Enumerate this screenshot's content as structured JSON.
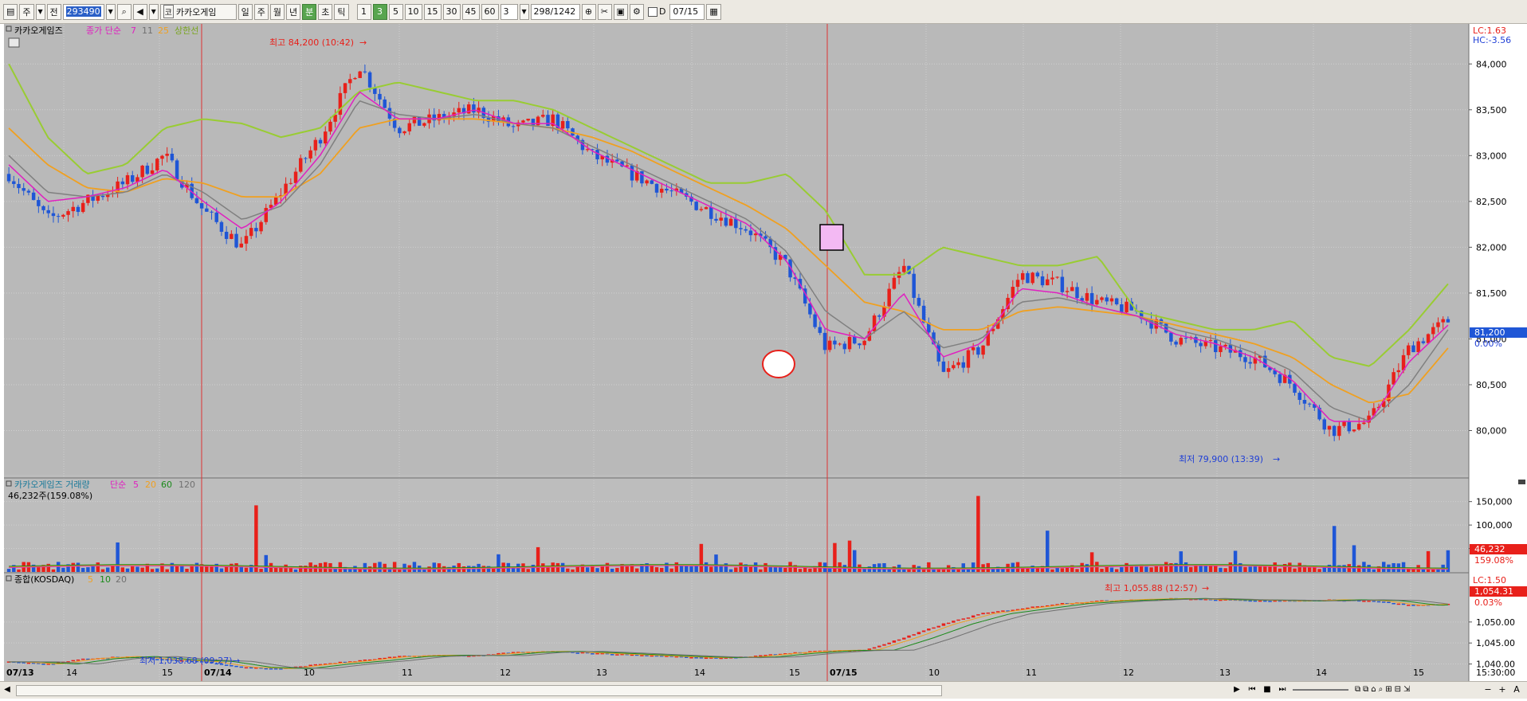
{
  "toolbar": {
    "code": "293490",
    "tab_a": "주",
    "tab_b": "전",
    "name_badge": "코",
    "name": "카카오게임",
    "periods": [
      "일",
      "주",
      "월",
      "년",
      "분",
      "초",
      "틱"
    ],
    "active_period": "분",
    "intervals": [
      "1",
      "3",
      "5",
      "10",
      "15",
      "30",
      "45",
      "60"
    ],
    "active_interval": "3",
    "count_value": "3",
    "position": "298",
    "total": "/1242",
    "d_label": "D",
    "date": "07/15"
  },
  "price_panel": {
    "legend_title": "카카오게임즈",
    "legend_ma_label": "종가 단순",
    "legend_ma_periods": [
      "7",
      "11",
      "25"
    ],
    "legend_env": "상한선",
    "lc": "LC:1.63",
    "hc": "HC:-3.56",
    "high_note": "최고 84,200 (10:42)",
    "low_note": "최저 79,900 (13:39)",
    "current_price": "81,200",
    "current_pct": "0.00%",
    "y_ticks": [
      "84,000",
      "83,500",
      "83,000",
      "82,500",
      "82,000",
      "81,500",
      "81,000",
      "80,500",
      "80,000"
    ],
    "ylim": [
      79700,
      84350
    ]
  },
  "volume_panel": {
    "legend_title": "카카오게임즈 거래량",
    "legend_ma_label": "단순",
    "legend_ma_periods": [
      "5",
      "20",
      "60",
      "120"
    ],
    "last_volume": "46,232주(159.08%)",
    "current_value": "46,232",
    "current_pct": "159.08%",
    "y_ticks": [
      "150,000",
      "100,000",
      "50,000"
    ],
    "ylim": [
      0,
      180000
    ]
  },
  "index_panel": {
    "legend_title": "종합(KOSDAQ)",
    "legend_ma_periods": [
      "5",
      "10",
      "20"
    ],
    "lc": "LC:1.50",
    "high_note": "최고 1,055.88 (12:57)",
    "low_note": "최저 1,038.68 (09:27)",
    "current_value": "1,054.31",
    "current_pct": "0.03%",
    "y_ticks": [
      "1,050.00",
      "1,045.00",
      "1,040.00"
    ],
    "ylim": [
      1036.5,
      1058.5
    ]
  },
  "x_axis": {
    "labels": [
      "07/13",
      "14",
      "15",
      "07/14",
      "10",
      "11",
      "12",
      "13",
      "14",
      "15",
      "07/15",
      "10",
      "11",
      "12",
      "13",
      "14",
      "15"
    ],
    "time_readout": "15:30:00"
  },
  "colors": {
    "bg": "#bdbdbd",
    "up": "#e8201a",
    "down": "#1f56d6",
    "ma_short": "#e020c0",
    "ma_mid": "#808080",
    "ma_long": "#f0a020",
    "envelope": "#99cc33"
  },
  "chart_data": [
    {
      "type": "candlestick",
      "title": "카카오게임즈",
      "x_sessions": [
        "07/13 14:00",
        "07/13 15:00",
        "07/14 09:00",
        "07/14 10:00",
        "07/14 11:00",
        "07/14 12:00",
        "07/14 13:00",
        "07/14 14:00",
        "07/14 15:00",
        "07/15 09:00",
        "07/15 10:00",
        "07/15 11:00",
        "07/15 12:00",
        "07/15 13:00",
        "07/15 14:00",
        "07/15 15:00"
      ],
      "close_path": [
        82800,
        82300,
        82500,
        82700,
        83000,
        82400,
        82000,
        82600,
        83200,
        84000,
        83300,
        83400,
        83500,
        83300,
        83400,
        83000,
        82800,
        82600,
        82400,
        82200,
        81800,
        80900,
        81000,
        81800,
        80600,
        80900,
        81700,
        81600,
        81400,
        81300,
        81000,
        80900,
        80800,
        80500,
        80000,
        80100,
        80900,
        81200
      ],
      "ma_short_path": [
        82900,
        82500,
        82550,
        82650,
        82850,
        82500,
        82200,
        82500,
        83000,
        83700,
        83400,
        83400,
        83500,
        83350,
        83350,
        83050,
        82850,
        82650,
        82450,
        82250,
        81850,
        81100,
        81000,
        81500,
        80800,
        80950,
        81550,
        81500,
        81350,
        81250,
        81050,
        80950,
        80800,
        80550,
        80100,
        80100,
        80750,
        81150
      ],
      "ma_mid_path": [
        83000,
        82600,
        82550,
        82600,
        82800,
        82600,
        82300,
        82450,
        82900,
        83600,
        83450,
        83400,
        83450,
        83350,
        83300,
        83100,
        82900,
        82700,
        82500,
        82300,
        81950,
        81300,
        81000,
        81300,
        80900,
        81000,
        81400,
        81450,
        81350,
        81250,
        81100,
        81000,
        80850,
        80650,
        80250,
        80100,
        80500,
        81100
      ],
      "ma_long_path": [
        83300,
        82900,
        82650,
        82600,
        82750,
        82700,
        82550,
        82550,
        82800,
        83300,
        83400,
        83400,
        83400,
        83350,
        83300,
        83200,
        83050,
        82850,
        82650,
        82450,
        82200,
        81800,
        81400,
        81300,
        81100,
        81100,
        81300,
        81350,
        81300,
        81250,
        81150,
        81050,
        80950,
        80800,
        80500,
        80300,
        80400,
        80900
      ],
      "envelope_path": [
        84000,
        83200,
        82800,
        82900,
        83300,
        83400,
        83350,
        83200,
        83300,
        83700,
        83800,
        83700,
        83600,
        83600,
        83500,
        83300,
        83100,
        82900,
        82700,
        82700,
        82800,
        82400,
        81700,
        81700,
        82000,
        81900,
        81800,
        81800,
        81900,
        81300,
        81200,
        81100,
        81100,
        81200,
        80800,
        80700,
        81100,
        81600
      ],
      "high": 84200,
      "low": 79900,
      "last": 81200
    },
    {
      "type": "bar",
      "title": "카카오게임즈 거래량",
      "typical_volume": 15000,
      "spikes": [
        {
          "session": "07/14 09:00",
          "value": 142000
        },
        {
          "session": "07/14 14:00",
          "value": 162000
        },
        {
          "session": "07/15 09:00",
          "value": 88000
        },
        {
          "session": "07/15 13:00",
          "value": 98000
        },
        {
          "session": "07/15 15:00",
          "value": 46232
        }
      ]
    },
    {
      "type": "candlestick",
      "title": "종합(KOSDAQ)",
      "close_path": [
        1040.5,
        1040.0,
        1041.3,
        1041.8,
        1041.0,
        1040.6,
        1039.2,
        1038.9,
        1040.0,
        1040.8,
        1041.8,
        1042.1,
        1042.0,
        1042.8,
        1043.0,
        1042.6,
        1042.2,
        1041.8,
        1041.5,
        1041.7,
        1042.6,
        1043.2,
        1043.3,
        1046.2,
        1049.5,
        1052.0,
        1053.2,
        1054.4,
        1055.0,
        1055.4,
        1055.6,
        1055.3,
        1055.2,
        1055.0,
        1055.3,
        1055.1,
        1054.0,
        1054.3
      ],
      "high": 1055.88,
      "low": 1038.68,
      "last": 1054.31
    }
  ]
}
